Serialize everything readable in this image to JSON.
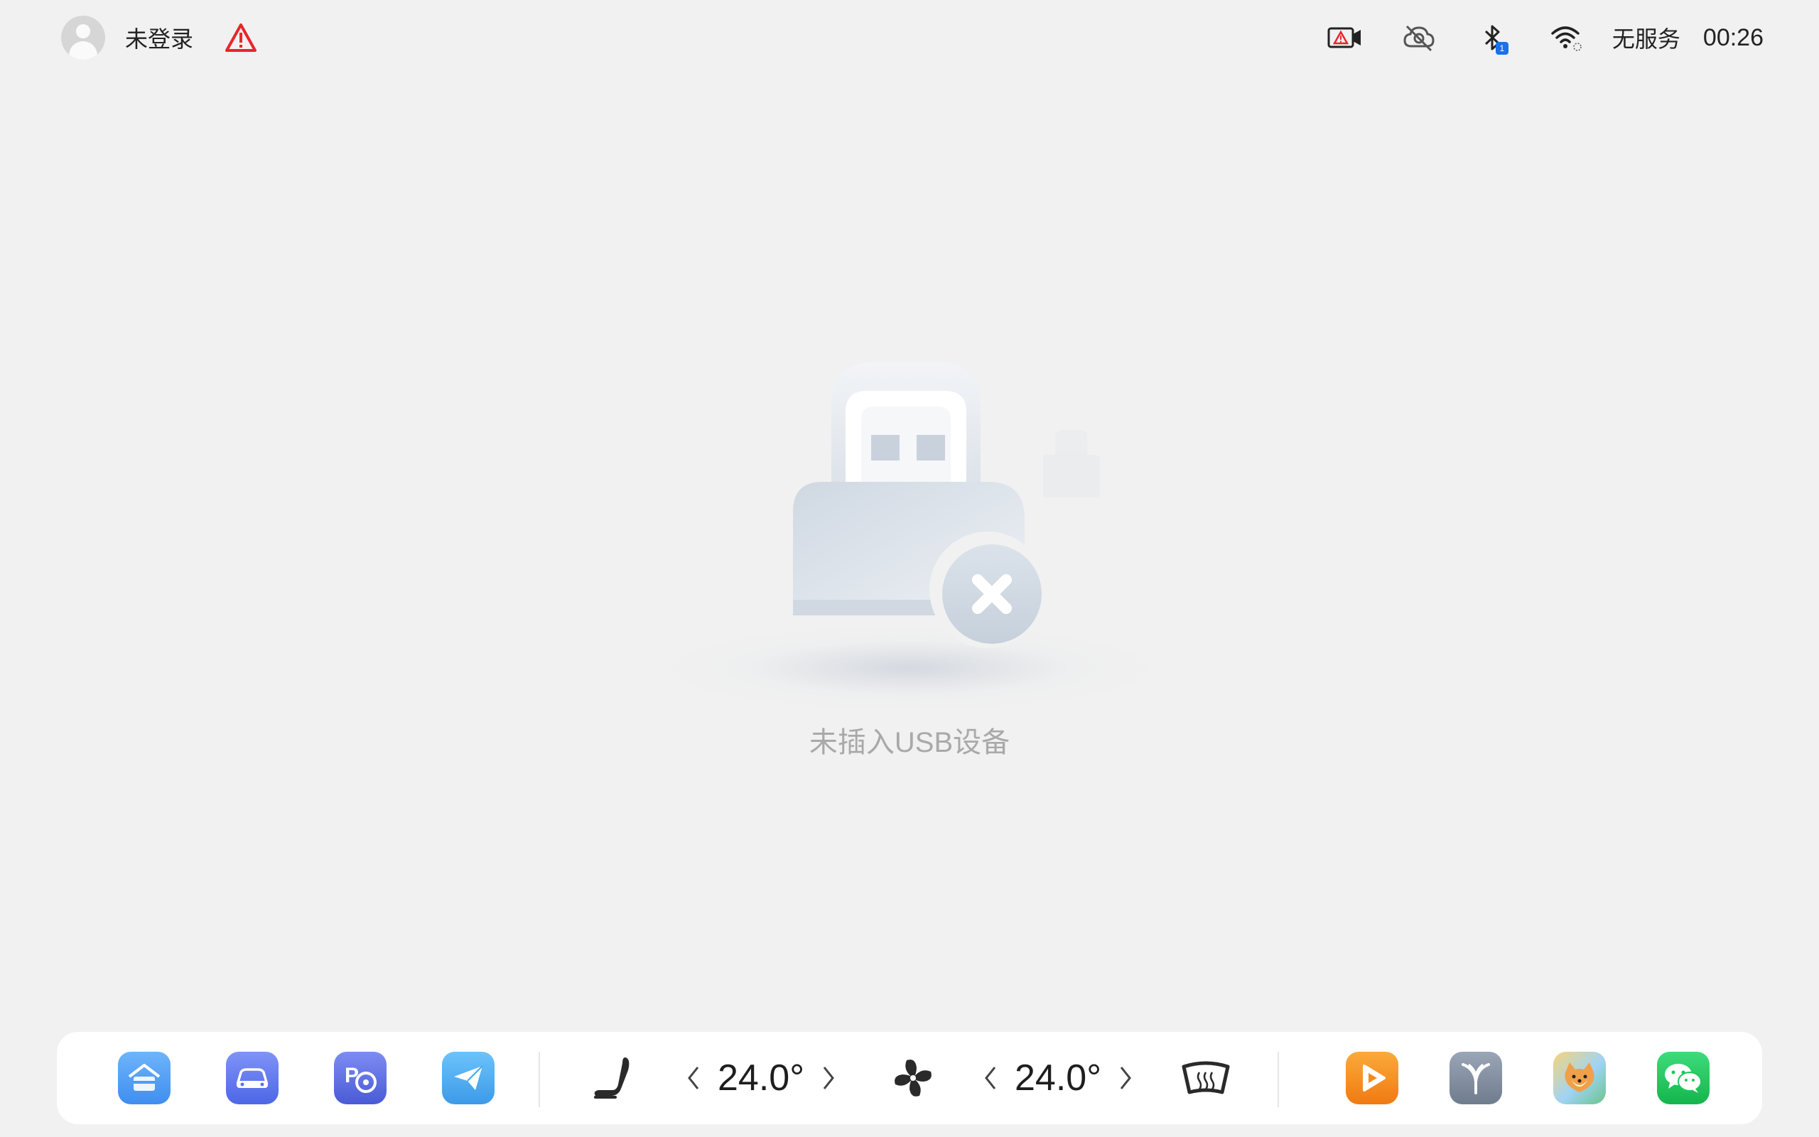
{
  "status_bar": {
    "user_label": "未登录",
    "service_label": "无服务",
    "time": "00:26",
    "bluetooth_badge": "1",
    "icons": [
      "avatar-icon",
      "warning-icon",
      "dashcam-warning-icon",
      "cloud-off-icon",
      "bluetooth-icon",
      "wifi-icon"
    ]
  },
  "main": {
    "empty_message": "未插入USB设备",
    "illustration": "usb-not-connected-icon"
  },
  "dock": {
    "left_apps": [
      {
        "name": "home-app",
        "icon": "home-icon",
        "color": "#4f9bf3"
      },
      {
        "name": "car-app",
        "icon": "car-icon",
        "color": "#5a73ee"
      },
      {
        "name": "parking-app",
        "icon": "parking-icon",
        "color": "#5a6cdf"
      },
      {
        "name": "telegram-app",
        "icon": "send-icon",
        "color": "#3fa5ee"
      }
    ],
    "seat_icon": "seat-heat-icon",
    "left_temp": "24.0°",
    "fan_icon": "fan-icon",
    "right_temp": "24.0°",
    "defrost_icon": "rear-defrost-icon",
    "right_apps": [
      {
        "name": "video-app",
        "icon": "play-icon",
        "color": "#f7941d"
      },
      {
        "name": "brand-app",
        "icon": "brand-logo-icon",
        "color": "#8693a4"
      },
      {
        "name": "shiba-app",
        "icon": "shiba-game-icon",
        "color": "#f0c36a"
      },
      {
        "name": "wechat-app",
        "icon": "wechat-icon",
        "color": "#1ec75a"
      }
    ]
  }
}
